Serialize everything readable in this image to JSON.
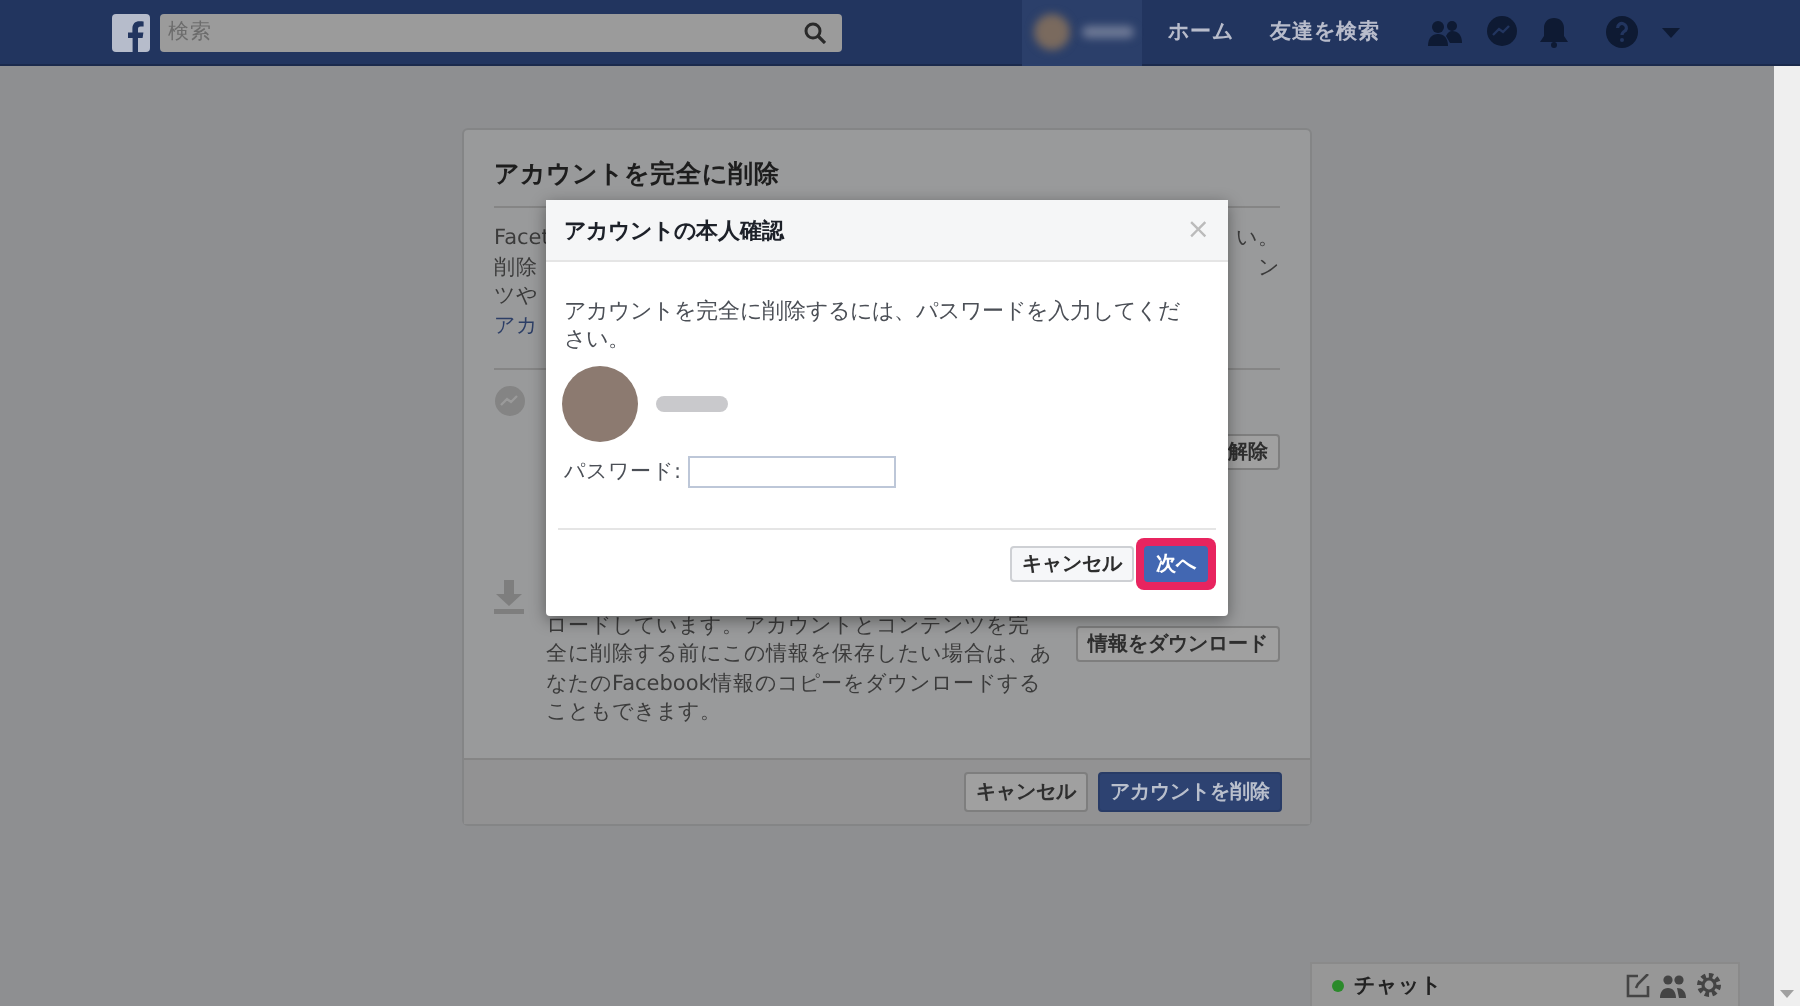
{
  "topbar": {
    "search": {
      "placeholder": "検索"
    },
    "nav": [
      "ホーム",
      "友達を検索"
    ]
  },
  "card": {
    "title": "アカウントを完全に削除",
    "intro_left": [
      {
        "text": "Facet",
        "kind": "plain"
      },
      {
        "text": "削除",
        "kind": "plain"
      },
      {
        "text": "ツや",
        "kind": "plain"
      },
      {
        "text": "アカ",
        "kind": "link"
      }
    ],
    "intro_right": [
      "い。",
      "ン"
    ],
    "messenger_button": "解除",
    "download_lines": [
      "ロードしています。アカウントとコンテンツを完",
      "全に削除する前にこの情報を保存したい場合は、あ",
      "なたのFacebook情報のコピーをダウンロードする",
      "こともできます。"
    ],
    "download_button": "情報をダウンロード",
    "buttons": [
      {
        "label": "キャンセル",
        "kind": "secondary"
      },
      {
        "label": "アカウントを削除",
        "kind": "primary"
      }
    ]
  },
  "dialog": {
    "title": "アカウントの本人確認",
    "close": "×",
    "message": "アカウントを完全に削除するには、パスワードを入力してください。",
    "password_label": "パスワード:",
    "buttons": [
      {
        "label": "キャンセル",
        "kind": "secondary",
        "highlighted": false
      },
      {
        "label": "次へ",
        "kind": "primary",
        "highlighted": true
      }
    ]
  },
  "chat": {
    "label": "チャット",
    "color": "#2b8a2b"
  }
}
